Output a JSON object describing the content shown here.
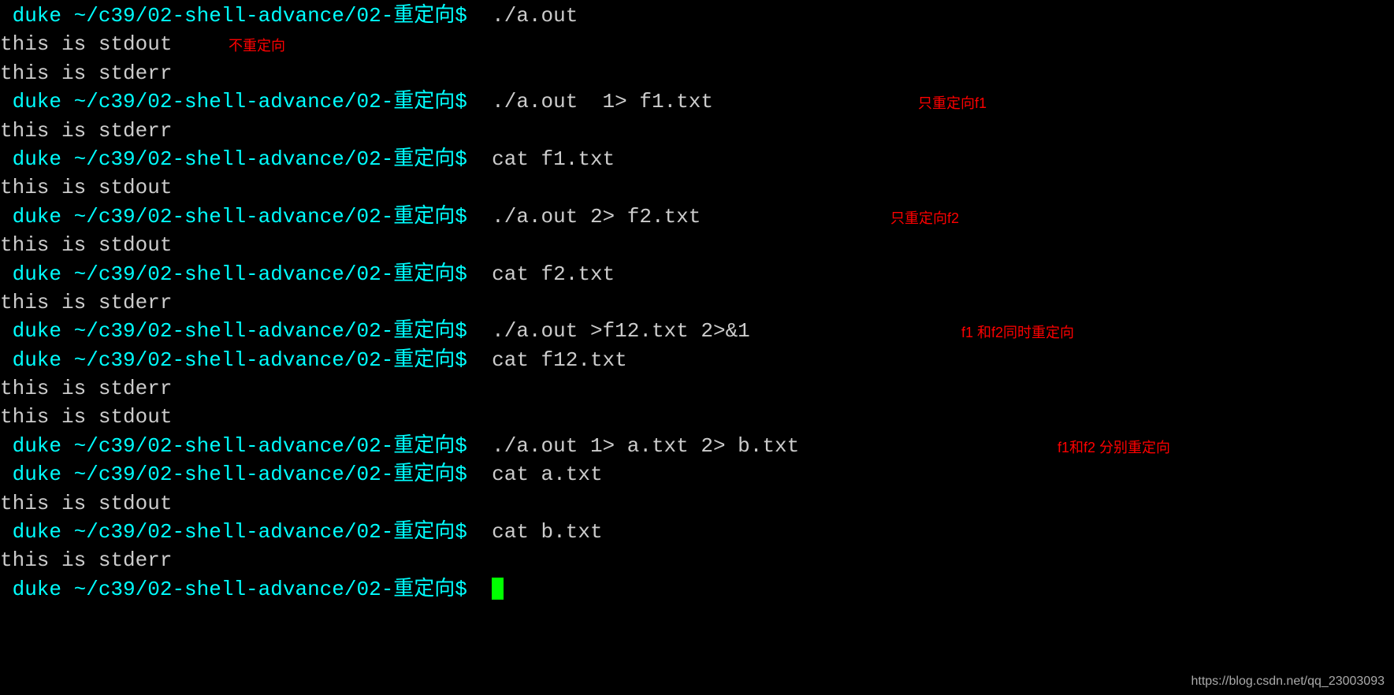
{
  "prompt": {
    "user": " duke ",
    "path": "~/c39/02-shell-advance/02-重定向",
    "dollar": "$ "
  },
  "lines": [
    {
      "type": "cmd",
      "cmd": " ./a.out"
    },
    {
      "type": "out",
      "text": "this is stdout",
      "ann": "不重定向",
      "annLeft": 290,
      "annTopOffset": 8
    },
    {
      "type": "out",
      "text": "this is stderr"
    },
    {
      "type": "cmd",
      "cmd": " ./a.out  1> f1.txt",
      "ann": "只重定向f1",
      "annLeft": 1165,
      "annTopOffset": 8
    },
    {
      "type": "out",
      "text": "this is stderr"
    },
    {
      "type": "cmd",
      "cmd": " cat f1.txt"
    },
    {
      "type": "out",
      "text": "this is stdout"
    },
    {
      "type": "cmd",
      "cmd": " ./a.out 2> f2.txt",
      "ann": "只重定向f2",
      "annLeft": 1130,
      "annTopOffset": 8
    },
    {
      "type": "out",
      "text": "this is stdout"
    },
    {
      "type": "cmd",
      "cmd": " cat f2.txt"
    },
    {
      "type": "out",
      "text": "this is stderr"
    },
    {
      "type": "cmd",
      "cmd": " ./a.out >f12.txt 2>&1",
      "ann": "f1 和f2同时重定向",
      "annLeft": 1220,
      "annTopOffset": 8
    },
    {
      "type": "cmd",
      "cmd": " cat f12.txt"
    },
    {
      "type": "out",
      "text": "this is stderr"
    },
    {
      "type": "out",
      "text": "this is stdout"
    },
    {
      "type": "cmd",
      "cmd": " ./a.out 1> a.txt 2> b.txt",
      "ann": "f1和f2 分别重定向",
      "annLeft": 1342,
      "annTopOffset": 8
    },
    {
      "type": "cmd",
      "cmd": " cat a.txt"
    },
    {
      "type": "out",
      "text": "this is stdout"
    },
    {
      "type": "cmd",
      "cmd": " cat b.txt"
    },
    {
      "type": "out",
      "text": "this is stderr"
    },
    {
      "type": "cmd",
      "cmd": " ",
      "cursor": true
    }
  ],
  "watermark": "https://blog.csdn.net/qq_23003093"
}
